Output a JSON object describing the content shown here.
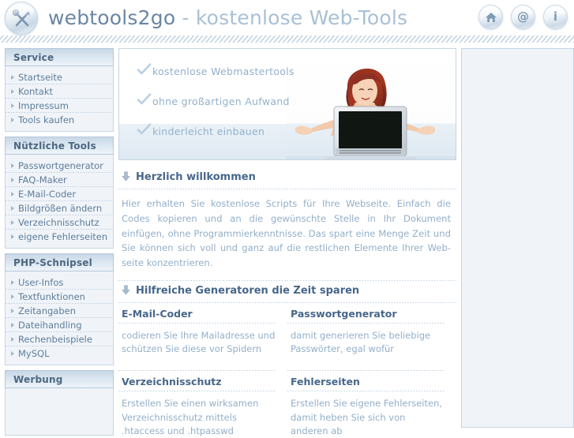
{
  "header": {
    "brand_name": "webtools2go",
    "brand_tagline": "- kostenlose Web-Tools",
    "logo_icon": "tools-circle-icon",
    "icons": [
      {
        "name": "home-icon",
        "glyph": ""
      },
      {
        "name": "at-email-icon",
        "glyph": "@"
      },
      {
        "name": "info-icon",
        "glyph": "i"
      }
    ]
  },
  "sidebar": {
    "boxes": [
      {
        "title": "Service",
        "items": [
          "Startseite",
          "Kontakt",
          "Impressum",
          "Tools kaufen"
        ]
      },
      {
        "title": "Nützliche Tools",
        "items": [
          "Passwortgenerator",
          "FAQ-Maker",
          "E-Mail-Coder",
          "Bildgrößen ändern",
          "Verzeichnisschutz",
          "eigene Fehlerseiten"
        ]
      },
      {
        "title": "PHP-Schnipsel",
        "items": [
          "User-Infos",
          "Textfunktionen",
          "Zeitangaben",
          "Dateihandling",
          "Rechenbeispiele",
          "MySQL"
        ]
      },
      {
        "title": "Werbung",
        "items": []
      }
    ]
  },
  "banner": {
    "bullets": [
      "kostenlose Webmastertools",
      "ohne großartigen Aufwand",
      "kinderleicht einbauen"
    ],
    "image_alt": "woman-with-laptop-photo"
  },
  "welcome": {
    "heading": "Herzlich willkommen",
    "body": "Hier erhalten Sie kostenlose Scripts für Ihre Webseite. Einfach die Codes kopieren und an die gewünschte Stelle in Ihr Dokument einfügen, ohne Programmierkenntnisse. Das spart eine Menge Zeit und Sie können sich voll und ganz auf die restlichen Elemente Ihrer Web- seite konzentrieren."
  },
  "generators": {
    "heading": "Hilfreiche Generatoren die Zeit sparen",
    "items": [
      {
        "title": "E-Mail-Coder",
        "text": "codieren Sie Ihre Mailadresse und schützen Sie diese vor Spidern"
      },
      {
        "title": "Passwortgenerator",
        "text": "damit generieren Sie beliebige Passwörter, egal wofür"
      },
      {
        "title": "Verzeichnisschutz",
        "text": "Erstellen Sie einen wirksamen Verzeichnisschutz mittels .htaccess und .htpasswd"
      },
      {
        "title": "Fehlerseiten",
        "text": "Erstellen Sie eigene Fehlerseiten, damit heben Sie sich von anderen ab"
      }
    ]
  },
  "colors": {
    "accent": "#6a86a3",
    "panel_bg": "#f0f4f9",
    "border": "#c6d5e3",
    "text_body": "#93afc9",
    "heading": "#47678a"
  }
}
